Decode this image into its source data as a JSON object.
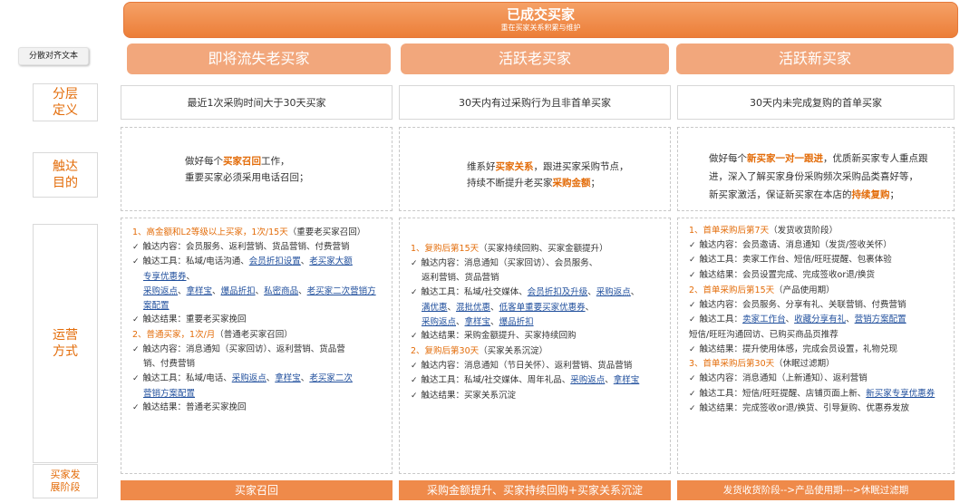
{
  "banner": {
    "title": "已成交买家",
    "subtitle": "重在买家关系积累与维护"
  },
  "align_tag": "分散对齐文本",
  "columns": [
    {
      "header": "即将流失老买家"
    },
    {
      "header": "活跃老买家"
    },
    {
      "header": "活跃新买家"
    }
  ],
  "rows": {
    "definition": "分层定义",
    "definition_l1": "分层",
    "definition_l2": "定义",
    "goal_l1": "触达",
    "goal_l2": "目的",
    "ops_l1": "运营",
    "ops_l2": "方式",
    "stage_l1": "买家发",
    "stage_l2": "展阶段"
  },
  "definitions": [
    "最近1次采购时间大于30天买家",
    "30天内有过采购行为且非首单买家",
    "30天内未完成复购的首单买家"
  ],
  "goals": {
    "c1": {
      "a": "做好每个",
      "b": "买家召回",
      "c": "工作，",
      "d": "重要买家必须采用电话召回；"
    },
    "c2": {
      "a": "维系好",
      "b": "买家关系",
      "c": "，跟进买家采购节点，",
      "d": "持续不断提升老买家",
      "e": "采购金额",
      "f": "；"
    },
    "c3": {
      "a": "做好每个",
      "b": "新买家一对一跟进",
      "c": "，优质新买家专人重点跟",
      "d": "进，深入了解买家身份采购频次采购品类喜好等，",
      "e": "新买家激活，保证新买家在本店的",
      "f": "持续复购",
      "g": "；"
    }
  },
  "ops": {
    "c1": {
      "h1": "1、高金额和L2等级以上买家，1次/15天",
      "h1_sub": "（重要老买家召回）",
      "l1": "触达内容：会员服务、返利营销、货品营销、付费营销",
      "l2a": "触达工具：私域/电话沟通、",
      "l2b": "会员折扣设置",
      "l2c": "、",
      "l2d": "老买家大额",
      "l2e": "专享优惠券",
      "l2f": "、",
      "l3a": "采购返点",
      "l3b": "、",
      "l3c": "拿样宝",
      "l3d": "、",
      "l3e": "爆品折扣",
      "l3f": "、",
      "l3g": "私密商品",
      "l3h": "、",
      "l3i": "老买家二次营销方",
      "l3j": "案配置",
      "l4": "触达结果：重要老买家挽回",
      "h2": "2、普通买家，1次/月",
      "h2_sub": "（普通老买家召回）",
      "l5": "触达内容：消息通知（买家回访）、返利营销、货品营",
      "l5b": "销、付费营销",
      "l6a": "触达工具：私域/电话、",
      "l6b": "采购返点",
      "l6c": "、",
      "l6d": "拿样宝",
      "l6e": "、",
      "l6f": "老买家二次",
      "l6g": "营销方案配置",
      "l7": "触达结果：普通老买家挽回"
    },
    "c2": {
      "h1": "1、复购后第15天",
      "h1_sub": "（买家持续回购、买家金额提升）",
      "l1": "触达内容：消息通知（买家回访）、会员服务、",
      "l1b": "返利营销、货品营销",
      "l2a": "触达工具：私域/社交媒体、",
      "l2b": "会员折扣及升级",
      "l2c": "、",
      "l2d": "采购返点",
      "l2e": "、",
      "l3a": "满优惠",
      "l3b": "、",
      "l3c": "混批优惠",
      "l3d": "、",
      "l3e": "低客单重要买家优惠券",
      "l3f": "、",
      "l4a": "采购返点",
      "l4b": "、",
      "l4c": "拿样宝",
      "l4d": "、",
      "l4e": "爆品折扣",
      "l5": "触达结果：采购金额提升、买家持续回购",
      "h2": "2、复购后第30天",
      "h2_sub": "（买家关系沉淀）",
      "l6": "触达内容：消息通知（节日关怀）、返利营销、货品营销",
      "l7a": "触达工具：私域/社交媒体、周年礼品、",
      "l7b": "采购返点",
      "l7c": "、",
      "l7d": "拿样宝",
      "l8": "触达结果：买家关系沉淀"
    },
    "c3": {
      "h1": "1、首单采购后第7天",
      "h1_sub": "（发货收货阶段）",
      "l1": "触达内容：会员邀请、消息通知（发货/签收关怀）",
      "l2": "触达工具：卖家工作台、短信/旺旺提醒、包裹体验",
      "l3": "触达结果：会员设置完成、完成签收or退/换货",
      "h2": "2、首单采购后第15天",
      "h2_sub": "（产品使用期）",
      "l4": "触达内容：会员服务、分享有礼、关联营销、付费营销",
      "l5a": "触达工具：",
      "l5b": "卖家工作台",
      "l5c": "、",
      "l5d": "收藏分享有礼",
      "l5e": "、",
      "l5f": "营销方案配置",
      "l5g": "短信/旺旺沟通回访、已购买商品页推荐",
      "l6": "触达结果：提升使用体感，完成会员设置，礼物兑现",
      "h3": "3、首单采购后第30天",
      "h3_sub": "（休眠过滤期）",
      "l7": "触达内容：消息通知（上新通知）、返利营销",
      "l8a": "触达工具：短信/旺旺提醒、店铺页面上新、",
      "l8b": "新买家专享优惠券",
      "l9": "触达结果：完成签收or退/换货、引导复购、优惠券发放"
    }
  },
  "footers": [
    "买家召回",
    "采购金额提升、买家持续回购+买家关系沉淀",
    "发货收货阶段-->产品使用期--->休眠过滤期"
  ]
}
